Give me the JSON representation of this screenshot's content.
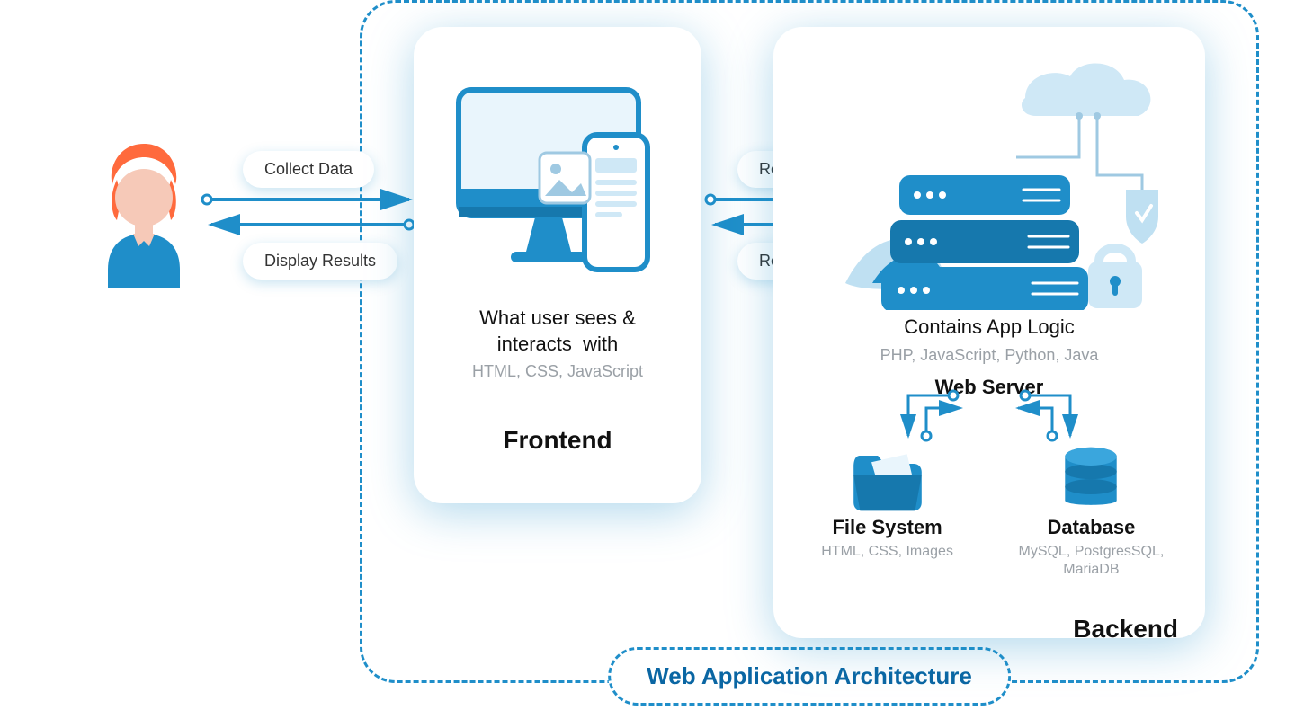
{
  "title": "Web Application Architecture",
  "user_frontend": {
    "top_label": "Collect Data",
    "bottom_label": "Display Results"
  },
  "frontend": {
    "heading": "Frontend",
    "desc_title": "What user sees & interacts  with",
    "desc_sub": "HTML, CSS, JavaScript"
  },
  "front_back": {
    "top_label": "Request",
    "bottom_label": "Response"
  },
  "backend": {
    "heading": "Backend",
    "app_logic_title": "Contains App Logic",
    "app_logic_sub": "PHP, JavaScript, Python, Java",
    "web_server": "Web Server",
    "file_system": {
      "title": "File System",
      "sub": "HTML, CSS, Images"
    },
    "database": {
      "title": "Database",
      "sub": "MySQL, PostgresSQL, MariaDB"
    }
  },
  "colors": {
    "accent": "#1f8ec9",
    "accent_dark": "#0a66a3"
  }
}
